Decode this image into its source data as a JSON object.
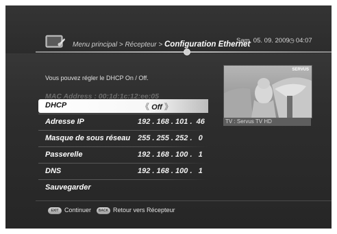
{
  "header": {
    "breadcrumb": {
      "root": "Menu principal",
      "sep1": " > ",
      "parent": "Récepteur",
      "sep2": " > ",
      "current": "Configuration Ethernet"
    },
    "date": "Sam, 05. 09. 2009",
    "time": "04:07",
    "app_icon": "tv-settings-icon",
    "clock_icon": "clock-icon"
  },
  "info_text": "Vous pouvez régler le DHCP On / Off.",
  "mac_address": "MAC Address : 00:1d:1c:12:ee:05",
  "settings": {
    "dhcp": {
      "label": "DHCP",
      "value": "Off",
      "arrow_left": "《",
      "arrow_right": "》"
    },
    "ip": {
      "label": "Adresse IP",
      "value": "192 . 168 . 101 .  46"
    },
    "mask": {
      "label": "Masque de sous réseau",
      "value": "255 . 255 . 252 .   0"
    },
    "gateway": {
      "label": "Passerelle",
      "value": "192 . 168 . 100 .   1"
    },
    "dns": {
      "label": "DNS",
      "value": "192 . 168 . 100 .   1"
    },
    "save": {
      "label": "Sauvegarder"
    }
  },
  "preview": {
    "caption": "TV : Servus TV HD",
    "badge": "SERVUS"
  },
  "footer": {
    "exit_key": "EXIT",
    "exit_label": "Continuer",
    "back_key": "BACK",
    "back_label": "Retour vers Récepteur"
  }
}
